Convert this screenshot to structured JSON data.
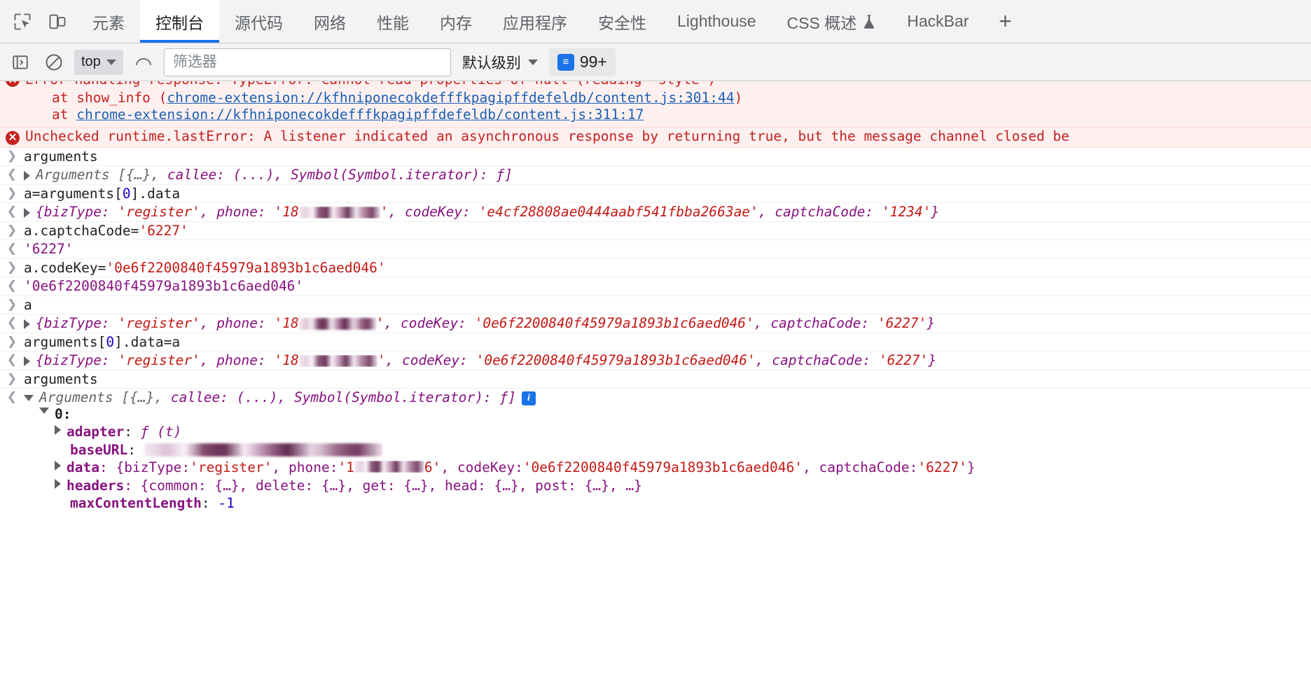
{
  "tabbar": {
    "inspect_icon": "inspect-element-icon",
    "device_icon": "device-toolbar-icon",
    "tabs": [
      {
        "label": "元素",
        "active": false
      },
      {
        "label": "控制台",
        "active": true
      },
      {
        "label": "源代码",
        "active": false
      },
      {
        "label": "网络",
        "active": false
      },
      {
        "label": "性能",
        "active": false
      },
      {
        "label": "内存",
        "active": false
      },
      {
        "label": "应用程序",
        "active": false
      },
      {
        "label": "安全性",
        "active": false
      },
      {
        "label": "Lighthouse",
        "active": false
      },
      {
        "label": "CSS 概述",
        "active": false,
        "icon": "flask-icon"
      },
      {
        "label": "HackBar",
        "active": false
      }
    ],
    "add_tab_label": "+"
  },
  "console_toolbar": {
    "sidebar_toggle_icon": "console-sidebar-icon",
    "clear_icon": "clear-console-icon",
    "context_value": "top",
    "eye_icon": "live-expression-icon",
    "filter_placeholder": "筛选器",
    "filter_value": "",
    "level_label": "默认级别",
    "issues_count": "99+",
    "issues_icon": "issue-icon"
  },
  "console": {
    "error_clipped": {
      "text": "Error handling response: TypeError: Cannot read properties of null (reading 'style')"
    },
    "error_stack": [
      {
        "prefix": "at show_info (",
        "link": "chrome-extension://kfhniponecokdefffkpagipffdefeldb/content.js:301:44",
        "suffix": ")"
      },
      {
        "prefix": "at ",
        "link": "chrome-extension://kfhniponecokdefffkpagipffdefeldb/content.js:311:17",
        "suffix": ""
      }
    ],
    "error_unchecked": {
      "text": "Unchecked runtime.lastError: A listener indicated an asynchronous response by returning true, but the message channel closed be"
    },
    "entries": {
      "e1_input": "arguments",
      "e1_output_prefix": "Arguments [{…}, ",
      "e1_output_callee": "callee: (...), ",
      "e1_output_symbol": "Symbol(Symbol.iterator): ƒ]",
      "e2_input_a": "a=arguments",
      "e2_input_idx": "0",
      "e2_input_tail": ".data",
      "e2_out_biztype_key": "bizType: ",
      "e2_out_biztype_val": "'register'",
      "e2_out_phone_key": ", phone: ",
      "e2_out_phone_pre": "'18",
      "e2_out_phone_post": "'",
      "e2_out_codekey_key": ", codeKey: ",
      "e2_out_codekey_val": "'e4cf28808ae0444aabf541fbba2663ae'",
      "e2_out_captcha_key": ", captchaCode: ",
      "e2_out_captcha_val": "'1234'",
      "e3_input_pre": "a.captchaCode=",
      "e3_input_val": "'6227'",
      "e3_output": "'6227'",
      "e4_input_pre": "a.codeKey=",
      "e4_input_val": "'0e6f2200840f45979a1893b1c6aed046'",
      "e4_output": "'0e6f2200840f45979a1893b1c6aed046'",
      "e5_input": "a",
      "e5_out_codekey_val": "'0e6f2200840f45979a1893b1c6aed046'",
      "e5_out_captcha_val": "'6227'",
      "e6_input_pre": "arguments",
      "e6_input_idx": "0",
      "e6_input_tail": ".data=a",
      "e7_input": "arguments"
    },
    "expanded": {
      "root_prefix": "Arguments [{…}, ",
      "root_callee": "callee: (...), ",
      "root_symbol": "Symbol(Symbol.iterator): ƒ]",
      "index_label": "0:",
      "adapter_name": "adapter",
      "adapter_value": "ƒ (t)",
      "baseurl_name": "baseURL",
      "data_name": "data",
      "data_biztype_key": ": {bizType: ",
      "data_biztype_val": "'register'",
      "data_phone_key": ", phone: ",
      "data_phone_pre": "'1",
      "data_phone_post": "6'",
      "data_codekey_key": ", codeKey: ",
      "data_codekey_val": "'0e6f2200840f45979a1893b1c6aed046'",
      "data_captcha_key": ", captchaCode: ",
      "data_captcha_val": "'6227'",
      "data_close": "}",
      "headers_name": "headers",
      "headers_value": ": {common: {…}, delete: {…}, get: {…}, head: {…}, post: {…}, …}",
      "maxcontent_name": "maxContentLength",
      "maxcontent_value": "-1"
    }
  },
  "colors": {
    "accent": "#1a73e8",
    "error": "#c5221f",
    "link": "#1a5fb4",
    "string": "#c41a16",
    "property": "#881280",
    "number": "#1c00cf"
  }
}
